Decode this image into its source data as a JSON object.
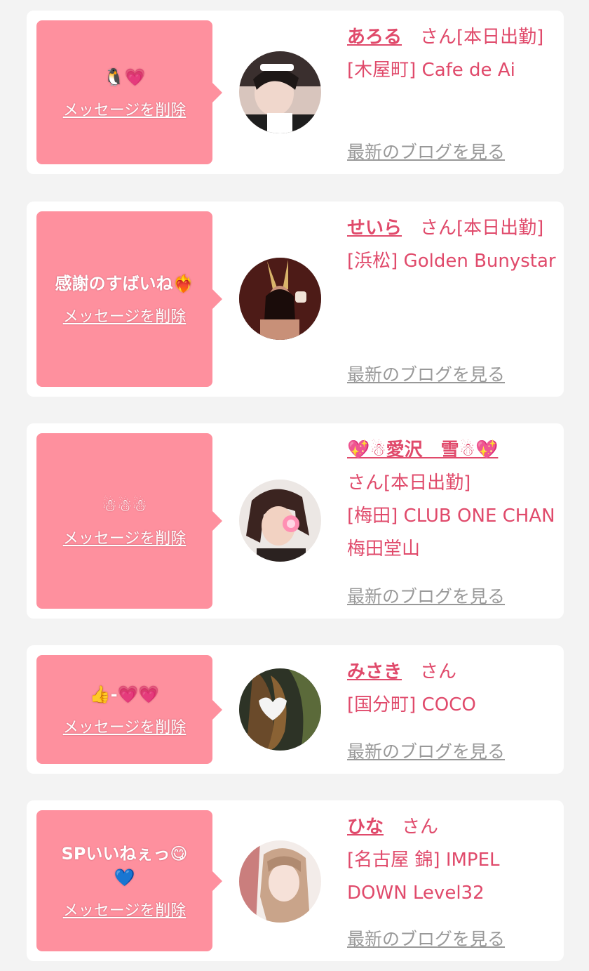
{
  "cards": [
    {
      "message": "🐧💗",
      "delete_label": "メッセージを削除",
      "name": "あろる",
      "san": "さん[本日出勤]",
      "shop": "[木屋町] Cafe de Ai",
      "blog_label": "最新のブログを見る"
    },
    {
      "message": "感謝のすばいね❤️‍🔥",
      "delete_label": "メッセージを削除",
      "name": "せいら",
      "san": "さん[本日出勤]",
      "shop": "[浜松] Golden Bunystar",
      "blog_label": "最新のブログを見る"
    },
    {
      "message": "☃☃☃",
      "delete_label": "メッセージを削除",
      "name": "💖☃愛沢　雪☃💖",
      "san": "さん[本日出勤]",
      "shop": "[梅田] CLUB ONE CHAN 梅田堂山",
      "blog_label": "最新のブログを見る"
    },
    {
      "message": "👍-💗💗",
      "delete_label": "メッセージを削除",
      "name": "みさき",
      "san": "さん",
      "shop": "[国分町] COCO",
      "blog_label": "最新のブログを見る"
    },
    {
      "message": "SPいいねぇっ😋💙",
      "delete_label": "メッセージを削除",
      "name": "ひな",
      "san": "さん",
      "shop": "[名古屋 錦] IMPEL DOWN Level32",
      "blog_label": "最新のブログを見る"
    }
  ],
  "colors": {
    "page_bg": "#f3f3f3",
    "bubble": "#fe909e",
    "accent_text": "#e04a6b",
    "link_gray": "#999999"
  }
}
